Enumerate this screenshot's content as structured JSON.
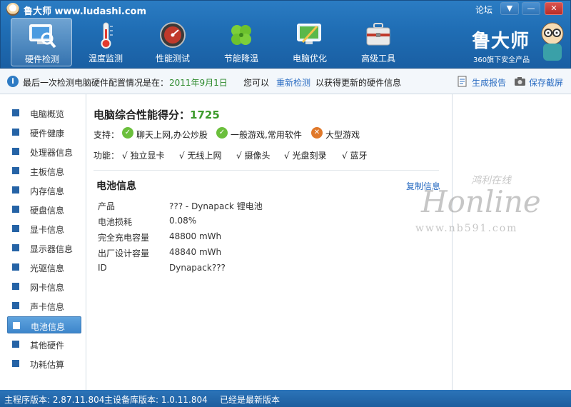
{
  "app": {
    "title": "鲁大师 www.ludashi.com",
    "forum": "论坛"
  },
  "window": {
    "menu_glyph": "▼",
    "min_glyph": "—",
    "close_glyph": "✕"
  },
  "toolbar": {
    "items": [
      {
        "label": "硬件检测",
        "icon": "monitor-magnifier-icon"
      },
      {
        "label": "温度监测",
        "icon": "thermometer-icon"
      },
      {
        "label": "性能测试",
        "icon": "speedometer-icon"
      },
      {
        "label": "节能降温",
        "icon": "clover-icon"
      },
      {
        "label": "电脑优化",
        "icon": "monitor-sweep-icon"
      },
      {
        "label": "高级工具",
        "icon": "toolbox-icon"
      }
    ],
    "active_index": 0
  },
  "brand": {
    "name": "鲁大师",
    "sub": "360旗下安全产品"
  },
  "infobar": {
    "prefix": "最后一次检测电脑硬件配置情况是在：",
    "date": "2011年9月1日",
    "mid": "您可以",
    "recheck": "重新检测",
    "suffix": "以获得更新的硬件信息",
    "report": "生成报告",
    "screenshot": "保存截屏"
  },
  "sidebar": {
    "items": [
      "电脑概览",
      "硬件健康",
      "处理器信息",
      "主板信息",
      "内存信息",
      "硬盘信息",
      "显卡信息",
      "显示器信息",
      "光驱信息",
      "网卡信息",
      "声卡信息",
      "电池信息",
      "其他硬件",
      "功耗估算"
    ],
    "active_index": 11
  },
  "main": {
    "score_label": "电脑综合性能得分：",
    "score": "1725",
    "support_label": "支持：",
    "support": [
      "聊天上网,办公炒股",
      "一般游戏,常用软件",
      "大型游戏"
    ],
    "feature_label": "功能：",
    "features": [
      "√ 独立显卡",
      "√ 无线上网",
      "√ 摄像头",
      "√ 光盘刻录",
      "√ 蓝牙"
    ],
    "section_title": "电池信息",
    "copy": "复制信息",
    "rows": [
      {
        "k": "产品",
        "v": "??? - Dynapack 锂电池"
      },
      {
        "k": "电池损耗",
        "v": "0.08%"
      },
      {
        "k": "完全充电容量",
        "v": "48800 mWh"
      },
      {
        "k": "出厂设计容量",
        "v": "48840 mWh"
      },
      {
        "k": "ID",
        "v": "Dynapack???"
      }
    ]
  },
  "watermark": {
    "cn": "鸿利在线",
    "en": "Honline",
    "url": "www.nb591.com"
  },
  "status": {
    "main_version": "主程序版本: 2.87.11.804",
    "db_version": "主设备库版本: 1.0.11.804",
    "latest": "已经是最新版本"
  },
  "colors": {
    "accent": "#1f6db4",
    "score": "#3d9b2c",
    "link": "#2a6cc2"
  }
}
